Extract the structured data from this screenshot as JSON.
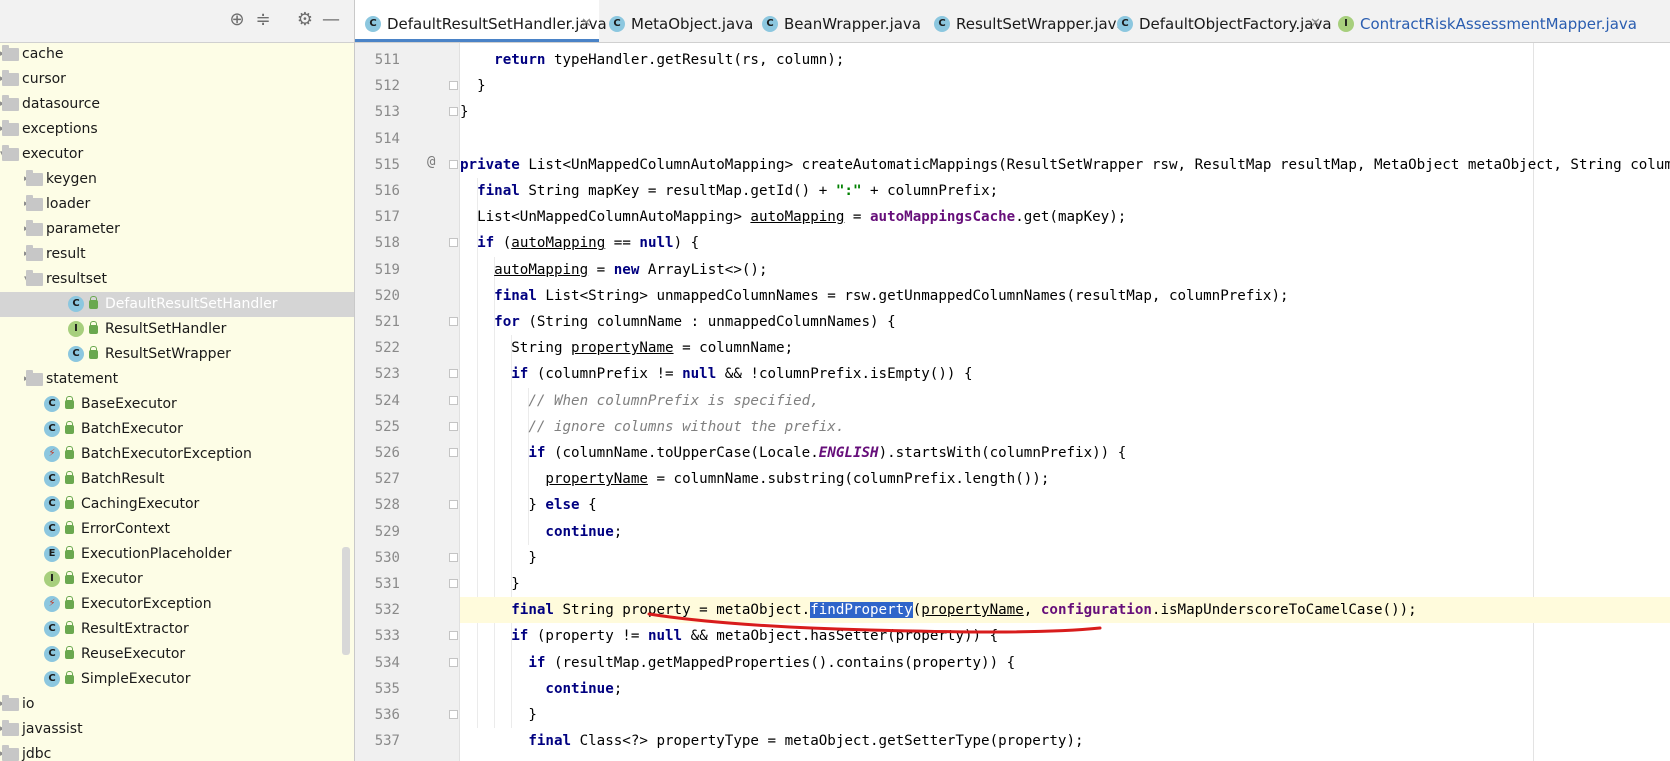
{
  "tree": {
    "toolbar": {
      "locate_icon": "crosshair-icon",
      "collapse_icon": "collapse-icon",
      "settings_icon": "gear-icon",
      "hide_icon": "minimize-icon"
    },
    "items": [
      {
        "label": "cache",
        "kind": "folder",
        "depth": 0,
        "arrow": "▸"
      },
      {
        "label": "cursor",
        "kind": "folder",
        "depth": 0,
        "arrow": "▸"
      },
      {
        "label": "datasource",
        "kind": "folder",
        "depth": 0,
        "arrow": "▸"
      },
      {
        "label": "exceptions",
        "kind": "folder",
        "depth": 0,
        "arrow": "▸"
      },
      {
        "label": "executor",
        "kind": "folder",
        "depth": 0,
        "arrow": "▾"
      },
      {
        "label": "keygen",
        "kind": "folder",
        "depth": 1,
        "arrow": "▸"
      },
      {
        "label": "loader",
        "kind": "folder",
        "depth": 1,
        "arrow": "▸"
      },
      {
        "label": "parameter",
        "kind": "folder",
        "depth": 1,
        "arrow": "▸"
      },
      {
        "label": "result",
        "kind": "folder",
        "depth": 1,
        "arrow": "▸"
      },
      {
        "label": "resultset",
        "kind": "folder",
        "depth": 1,
        "arrow": "▾"
      },
      {
        "label": "DefaultResultSetHandler",
        "kind": "C",
        "depth": 2,
        "selected": true
      },
      {
        "label": "ResultSetHandler",
        "kind": "I",
        "depth": 2
      },
      {
        "label": "ResultSetWrapper",
        "kind": "C",
        "depth": 2
      },
      {
        "label": "statement",
        "kind": "folder",
        "depth": 1,
        "arrow": "▸"
      },
      {
        "label": "BaseExecutor",
        "kind": "C",
        "depth": 1
      },
      {
        "label": "BatchExecutor",
        "kind": "C",
        "depth": 1
      },
      {
        "label": "BatchExecutorException",
        "kind": "X",
        "depth": 1
      },
      {
        "label": "BatchResult",
        "kind": "C",
        "depth": 1
      },
      {
        "label": "CachingExecutor",
        "kind": "C",
        "depth": 1
      },
      {
        "label": "ErrorContext",
        "kind": "C",
        "depth": 1
      },
      {
        "label": "ExecutionPlaceholder",
        "kind": "E",
        "depth": 1
      },
      {
        "label": "Executor",
        "kind": "I",
        "depth": 1
      },
      {
        "label": "ExecutorException",
        "kind": "X",
        "depth": 1
      },
      {
        "label": "ResultExtractor",
        "kind": "C",
        "depth": 1
      },
      {
        "label": "ReuseExecutor",
        "kind": "C",
        "depth": 1
      },
      {
        "label": "SimpleExecutor",
        "kind": "C",
        "depth": 1
      },
      {
        "label": "io",
        "kind": "folder",
        "depth": 0,
        "arrow": "▸"
      },
      {
        "label": "javassist",
        "kind": "folder",
        "depth": 0,
        "arrow": "▸"
      },
      {
        "label": "jdbc",
        "kind": "folder",
        "depth": 0,
        "arrow": "▸"
      }
    ]
  },
  "tabs": [
    {
      "label": "DefaultResultSetHandler.java",
      "icon": "C",
      "active": true,
      "closable": true
    },
    {
      "label": "MetaObject.java",
      "icon": "C",
      "active": false,
      "closable": false
    },
    {
      "label": "BeanWrapper.java",
      "icon": "C",
      "active": false,
      "closable": false
    },
    {
      "label": "ResultSetWrapper.java",
      "icon": "C",
      "active": false,
      "closable": false
    },
    {
      "label": "DefaultObjectFactory.java",
      "icon": "C",
      "active": false,
      "closable": true
    },
    {
      "label": "ContractRiskAssessmentMapper.java",
      "icon": "I",
      "active": false,
      "closable": false
    }
  ],
  "editor": {
    "current_line": 532,
    "lines": [
      {
        "n": 511,
        "html": "    <span class=\"kw\">return</span> typeHandler.getResult(rs, column);",
        "fold": false
      },
      {
        "n": 512,
        "html": "  }",
        "fold": true
      },
      {
        "n": 513,
        "html": "}",
        "fold": true
      },
      {
        "n": 514,
        "html": "",
        "fold": false
      },
      {
        "n": 515,
        "html": "<span class=\"kw\">private</span> List&lt;UnMappedColumnAutoMapping&gt; createAutomaticMappings(ResultSetWrapper rsw, ResultMap resultMap, MetaObject metaObject, String columnPrefix) {",
        "fold": true,
        "at": true
      },
      {
        "n": 516,
        "html": "  <span class=\"kw\">final</span> String mapKey = resultMap.getId() + <span class=\"str\">\":\"</span> + columnPrefix;",
        "fold": false
      },
      {
        "n": 517,
        "html": "  List&lt;UnMappedColumnAutoMapping&gt; <span class=\"ul\">autoMapping</span> = <span class=\"fld\">autoMappingsCache</span>.get(mapKey);",
        "fold": false
      },
      {
        "n": 518,
        "html": "  <span class=\"kw\">if</span> (<span class=\"ul\">autoMapping</span> == <span class=\"kw\">null</span>) {",
        "fold": true
      },
      {
        "n": 519,
        "html": "    <span class=\"ul\">autoMapping</span> = <span class=\"kw\">new</span> ArrayList&lt;&gt;();",
        "fold": false
      },
      {
        "n": 520,
        "html": "    <span class=\"kw\">final</span> List&lt;String&gt; unmappedColumnNames = rsw.getUnmappedColumnNames(resultMap, columnPrefix);",
        "fold": false
      },
      {
        "n": 521,
        "html": "    <span class=\"kw\">for</span> (String columnName : unmappedColumnNames) {",
        "fold": true
      },
      {
        "n": 522,
        "html": "      String <span class=\"ul\">propertyName</span> = columnName;",
        "fold": false
      },
      {
        "n": 523,
        "html": "      <span class=\"kw\">if</span> (columnPrefix != <span class=\"kw\">null</span> &amp;&amp; !columnPrefix.isEmpty()) {",
        "fold": true
      },
      {
        "n": 524,
        "html": "        <span class=\"cmt\">// When columnPrefix is specified,</span>",
        "fold": true
      },
      {
        "n": 525,
        "html": "        <span class=\"cmt\">// ignore columns without the prefix.</span>",
        "fold": true
      },
      {
        "n": 526,
        "html": "        <span class=\"kw\">if</span> (columnName.toUpperCase(Locale.<span class=\"sfld\">ENGLISH</span>).startsWith(columnPrefix)) {",
        "fold": true
      },
      {
        "n": 527,
        "html": "          <span class=\"ul\">propertyName</span> = columnName.substring(columnPrefix.length());",
        "fold": false
      },
      {
        "n": 528,
        "html": "        } <span class=\"kw\">else</span> {",
        "fold": true
      },
      {
        "n": 529,
        "html": "          <span class=\"kw\">continue</span>;",
        "fold": false
      },
      {
        "n": 530,
        "html": "        }",
        "fold": true
      },
      {
        "n": 531,
        "html": "      }",
        "fold": true
      },
      {
        "n": 532,
        "html": "      <span class=\"kw\">final</span> String property = metaObject.<span class=\"sel\">findProperty</span>(<span class=\"ul\">propertyName</span>, <span class=\"fld\">configuration</span>.isMapUnderscoreToCamelCase());",
        "fold": false
      },
      {
        "n": 533,
        "html": "      <span class=\"kw\">if</span> (property != <span class=\"kw\">null</span> &amp;&amp; metaObject.hasSetter(property)) {",
        "fold": true
      },
      {
        "n": 534,
        "html": "        <span class=\"kw\">if</span> (resultMap.getMappedProperties().contains(property)) {",
        "fold": true
      },
      {
        "n": 535,
        "html": "          <span class=\"kw\">continue</span>;",
        "fold": false
      },
      {
        "n": 536,
        "html": "        }",
        "fold": true
      },
      {
        "n": 537,
        "html": "        <span class=\"kw\">final</span> Class&lt;?&gt; propertyType = metaObject.getSetterType(property);",
        "fold": false
      }
    ]
  },
  "colors": {
    "tree_bg": "#fdfde6",
    "selection": "#2f65ca",
    "annotation_stroke": "#d81c1c",
    "current_line": "#fffbdc"
  }
}
